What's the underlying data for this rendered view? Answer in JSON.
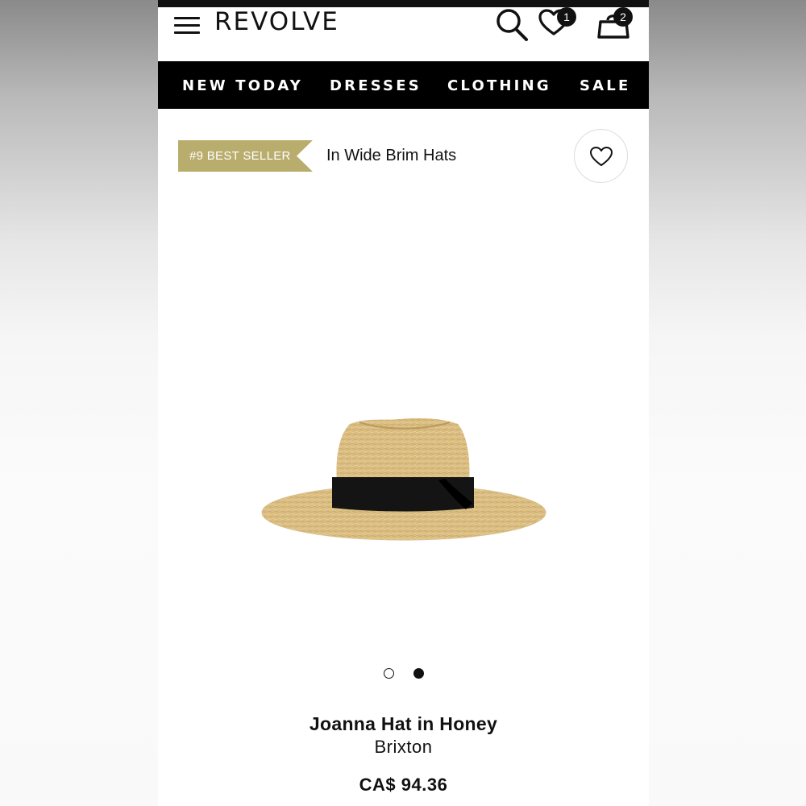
{
  "header": {
    "logo": "REVOLVE",
    "wishlist_count": "1",
    "bag_count": "2"
  },
  "nav": {
    "items": [
      "NEW TODAY",
      "DRESSES",
      "CLOTHING",
      "SALE"
    ]
  },
  "badge": {
    "label": "#9 BEST SELLER",
    "category": "In Wide Brim Hats"
  },
  "carousel": {
    "total": 2,
    "active_index": 2
  },
  "product": {
    "name": "Joanna Hat in Honey",
    "brand": "Brixton",
    "price": "CA$ 94.36"
  },
  "colors": {
    "ribbon": "#b9ad6e",
    "nav_bg": "#000000"
  },
  "icons": [
    "menu-icon",
    "search-icon",
    "heart-icon",
    "shopping-bag-icon"
  ]
}
